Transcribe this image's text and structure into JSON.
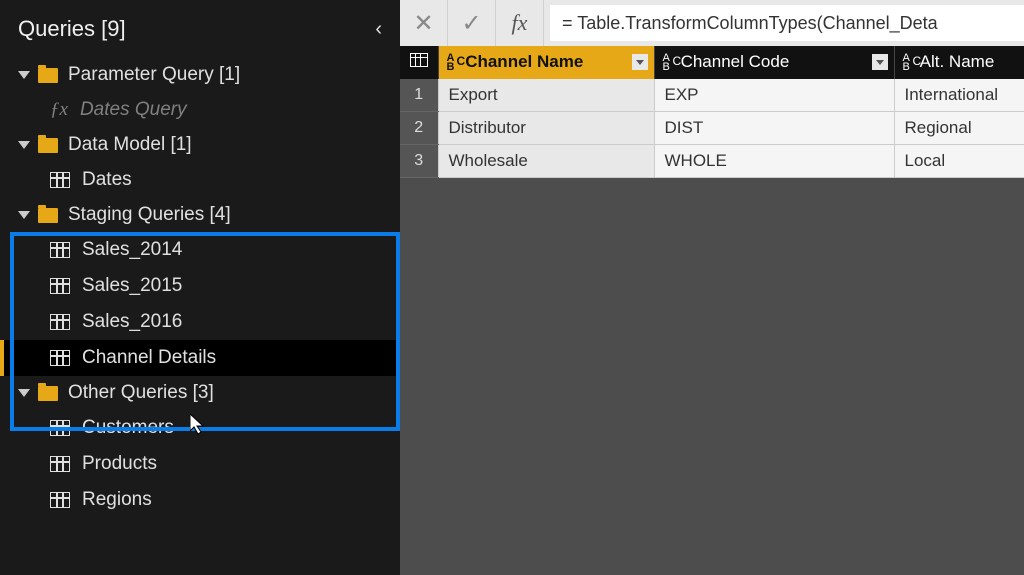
{
  "sidebar": {
    "title": "Queries [9]",
    "groups": [
      {
        "label": "Parameter Query [1]",
        "id": "parameter-query",
        "items": [
          {
            "label": "Dates Query",
            "type": "fx",
            "muted": true,
            "id": "dates-query"
          }
        ]
      },
      {
        "label": "Data Model [1]",
        "id": "data-model",
        "items": [
          {
            "label": "Dates",
            "type": "table",
            "id": "dates"
          }
        ]
      },
      {
        "label": "Staging Queries [4]",
        "id": "staging-queries",
        "items": [
          {
            "label": "Sales_2014",
            "type": "table",
            "id": "sales-2014"
          },
          {
            "label": "Sales_2015",
            "type": "table",
            "id": "sales-2015"
          },
          {
            "label": "Sales_2016",
            "type": "table",
            "id": "sales-2016"
          },
          {
            "label": "Channel Details",
            "type": "table",
            "id": "channel-details",
            "selected": true
          }
        ]
      },
      {
        "label": "Other Queries [3]",
        "id": "other-queries",
        "items": [
          {
            "label": "Customers",
            "type": "table",
            "id": "customers"
          },
          {
            "label": "Products",
            "type": "table",
            "id": "products"
          },
          {
            "label": "Regions",
            "type": "table",
            "id": "regions"
          }
        ]
      }
    ]
  },
  "formula_bar": {
    "fx_label": "fx",
    "value": "= Table.TransformColumnTypes(Channel_Deta"
  },
  "table": {
    "columns": [
      {
        "label": "Channel Name",
        "selected": true
      },
      {
        "label": "Channel Code",
        "selected": false
      },
      {
        "label": "Alt. Name",
        "selected": false
      }
    ],
    "rows": [
      {
        "n": "1",
        "cells": [
          "Export",
          "EXP",
          "International"
        ]
      },
      {
        "n": "2",
        "cells": [
          "Distributor",
          "DIST",
          "Regional"
        ]
      },
      {
        "n": "3",
        "cells": [
          "Wholesale",
          "WHOLE",
          "Local"
        ]
      }
    ]
  }
}
